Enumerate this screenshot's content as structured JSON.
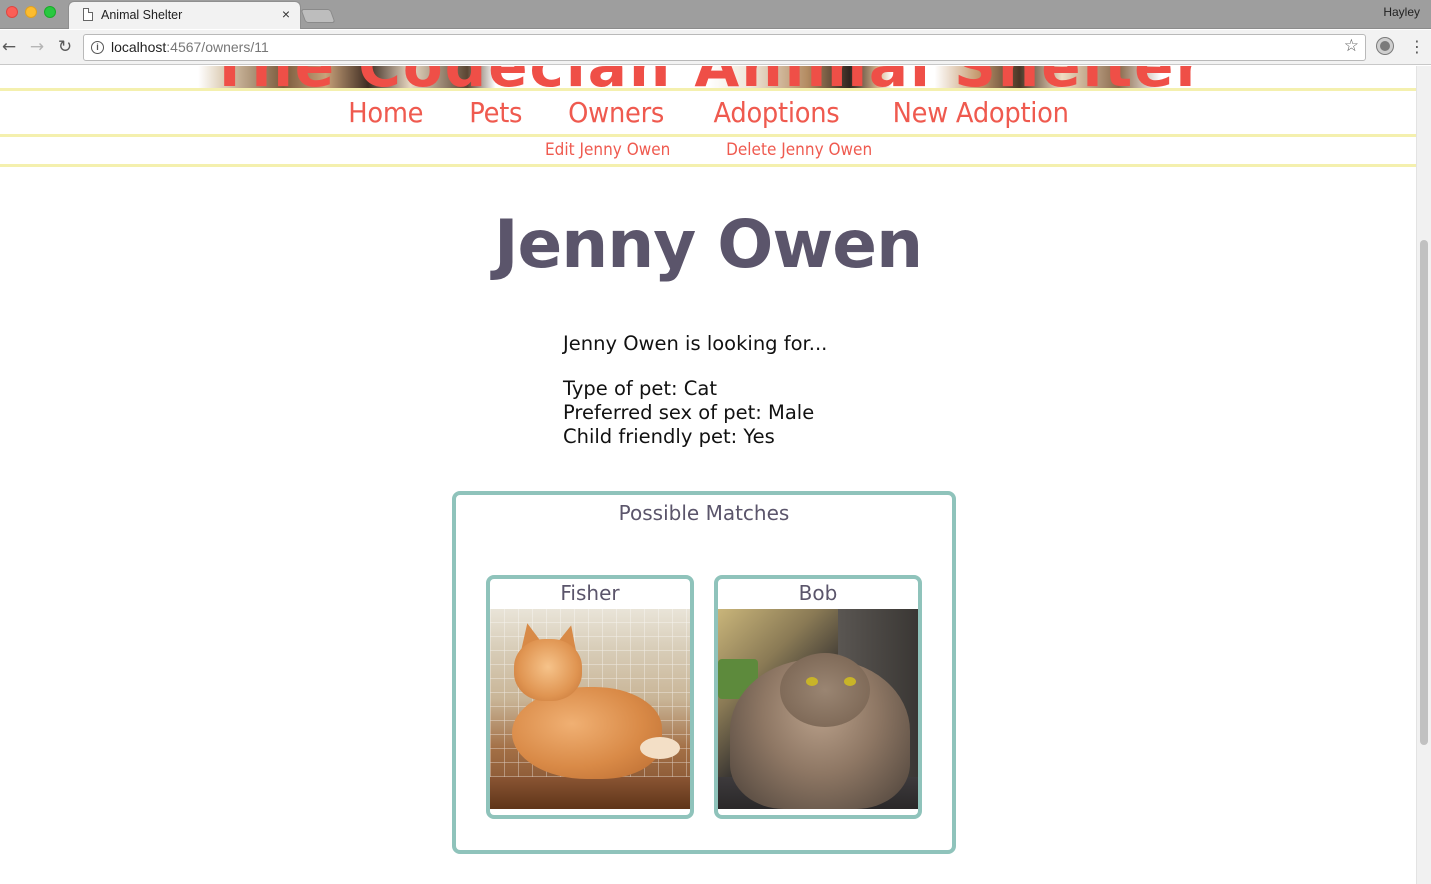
{
  "browser": {
    "tab_title": "Animal Shelter",
    "tab_close": "×",
    "profile_name": "Hayley",
    "url_host": "localhost",
    "url_rest": ":4567/owners/11",
    "icons": {
      "back": "back-arrow-icon",
      "forward": "forward-arrow-icon",
      "reload": "reload-icon",
      "info": "info-icon",
      "bookmark": "star-icon",
      "extension": "extension-icon",
      "menu": "kebab-menu-icon"
    }
  },
  "site": {
    "banner_title": "The Codeclan Animal Shelter",
    "nav": {
      "home": "Home",
      "pets": "Pets",
      "owners": "Owners",
      "adoptions": "Adoptions",
      "new_adoption": "New Adoption"
    },
    "sub_nav": {
      "edit": "Edit Jenny Owen",
      "delete": "Delete Jenny Owen"
    },
    "colors": {
      "accent": "#ef5a4f",
      "heading": "#5b556b",
      "border": "#8fc3bb",
      "divider": "#f4f0ae"
    }
  },
  "owner": {
    "name": "Jenny Owen",
    "intro": "Jenny Owen is looking for...",
    "type_of_pet": "Type of pet: Cat",
    "preferred_sex": "Preferred sex of pet: Male",
    "child_friendly": "Child friendly pet: Yes"
  },
  "matches": {
    "title": "Possible Matches",
    "pets": [
      {
        "name": "Fisher"
      },
      {
        "name": "Bob"
      }
    ]
  }
}
